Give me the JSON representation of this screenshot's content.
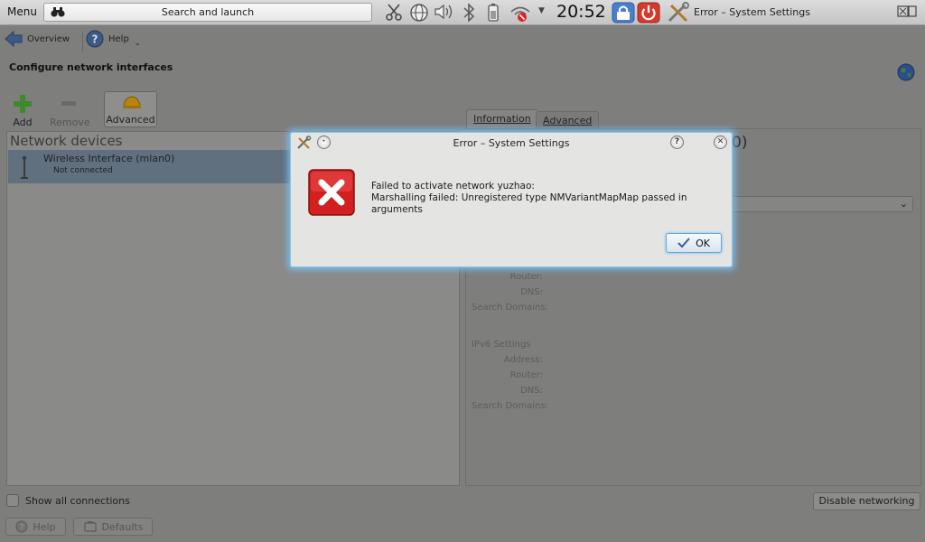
{
  "panel": {
    "menu_label": "Menu",
    "search_label": "Search and launch",
    "clock": "20:52",
    "active_window_title": "Error – System Settings",
    "tray_icons": [
      "scissors-icon",
      "network-globe-icon",
      "volume-icon",
      "bluetooth-icon",
      "battery-icon",
      "wifi-disconnected-icon",
      "chevron-down-icon",
      "lock-screen-icon",
      "power-icon",
      "system-settings-icon"
    ]
  },
  "nav": {
    "overview_label": "Overview",
    "help_label": "Help"
  },
  "page": {
    "title": "Configure network interfaces"
  },
  "toolbar": {
    "add_label": "Add",
    "remove_label": "Remove",
    "advanced_label": "Advanced"
  },
  "devices": {
    "header": "Network devices",
    "items": [
      {
        "name": "Wireless Interface (mlan0)",
        "status": "Not connected"
      }
    ]
  },
  "tabs": [
    {
      "label": "Information",
      "active": true
    },
    {
      "label": "Advanced",
      "active": false
    }
  ],
  "info": {
    "title_fragment": "0)",
    "ipv4_labels": [
      "Router:",
      "DNS:",
      "Search Domains:"
    ],
    "ipv6_heading": "IPv6 Settings",
    "ipv6_labels": [
      "Address:",
      "Router:",
      "DNS:",
      "Search Domains:"
    ]
  },
  "bottom": {
    "show_all_label": "Show all connections",
    "disable_networking_label": "Disable networking",
    "help_label": "Help",
    "defaults_label": "Defaults"
  },
  "dialog": {
    "title": "Error – System Settings",
    "message_line1": "Failed to activate network yuzhao:",
    "message_line2": "Marshalling failed: Unregistered type NMVariantMapMap passed in arguments",
    "ok_label": "OK"
  },
  "colors": {
    "dialog_glow": "#78c8ff",
    "error_red": "#d21f1f",
    "selection": "#60707f"
  }
}
